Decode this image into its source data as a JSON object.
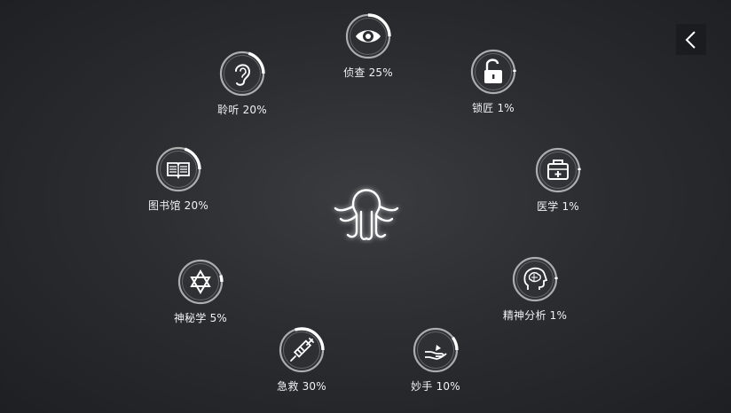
{
  "back": {
    "icon": "chevron-left-icon"
  },
  "center": {
    "icon": "octopus-icon"
  },
  "skills": [
    {
      "name": "侦查",
      "percent": 25,
      "label": "侦查 25%",
      "icon": "eye-icon"
    },
    {
      "name": "锁匠",
      "percent": 1,
      "label": "锁匠 1%",
      "icon": "padlock-icon"
    },
    {
      "name": "医学",
      "percent": 1,
      "label": "医学 1%",
      "icon": "medkit-icon"
    },
    {
      "name": "精神分析",
      "percent": 1,
      "label": "精神分析 1%",
      "icon": "brain-head-icon"
    },
    {
      "name": "妙手",
      "percent": 10,
      "label": "妙手 10%",
      "icon": "hand-icon"
    },
    {
      "name": "急救",
      "percent": 30,
      "label": "急救 30%",
      "icon": "syringe-icon"
    },
    {
      "name": "神秘学",
      "percent": 5,
      "label": "神秘学 5%",
      "icon": "hexagram-icon"
    },
    {
      "name": "图书馆",
      "percent": 20,
      "label": "图书馆 20%",
      "icon": "book-icon"
    },
    {
      "name": "聆听",
      "percent": 20,
      "label": "聆听 20%",
      "icon": "ear-icon"
    }
  ],
  "colors": {
    "ring": "#d8d8d8",
    "progress": "#ffffff",
    "text": "#f2f2f2"
  }
}
